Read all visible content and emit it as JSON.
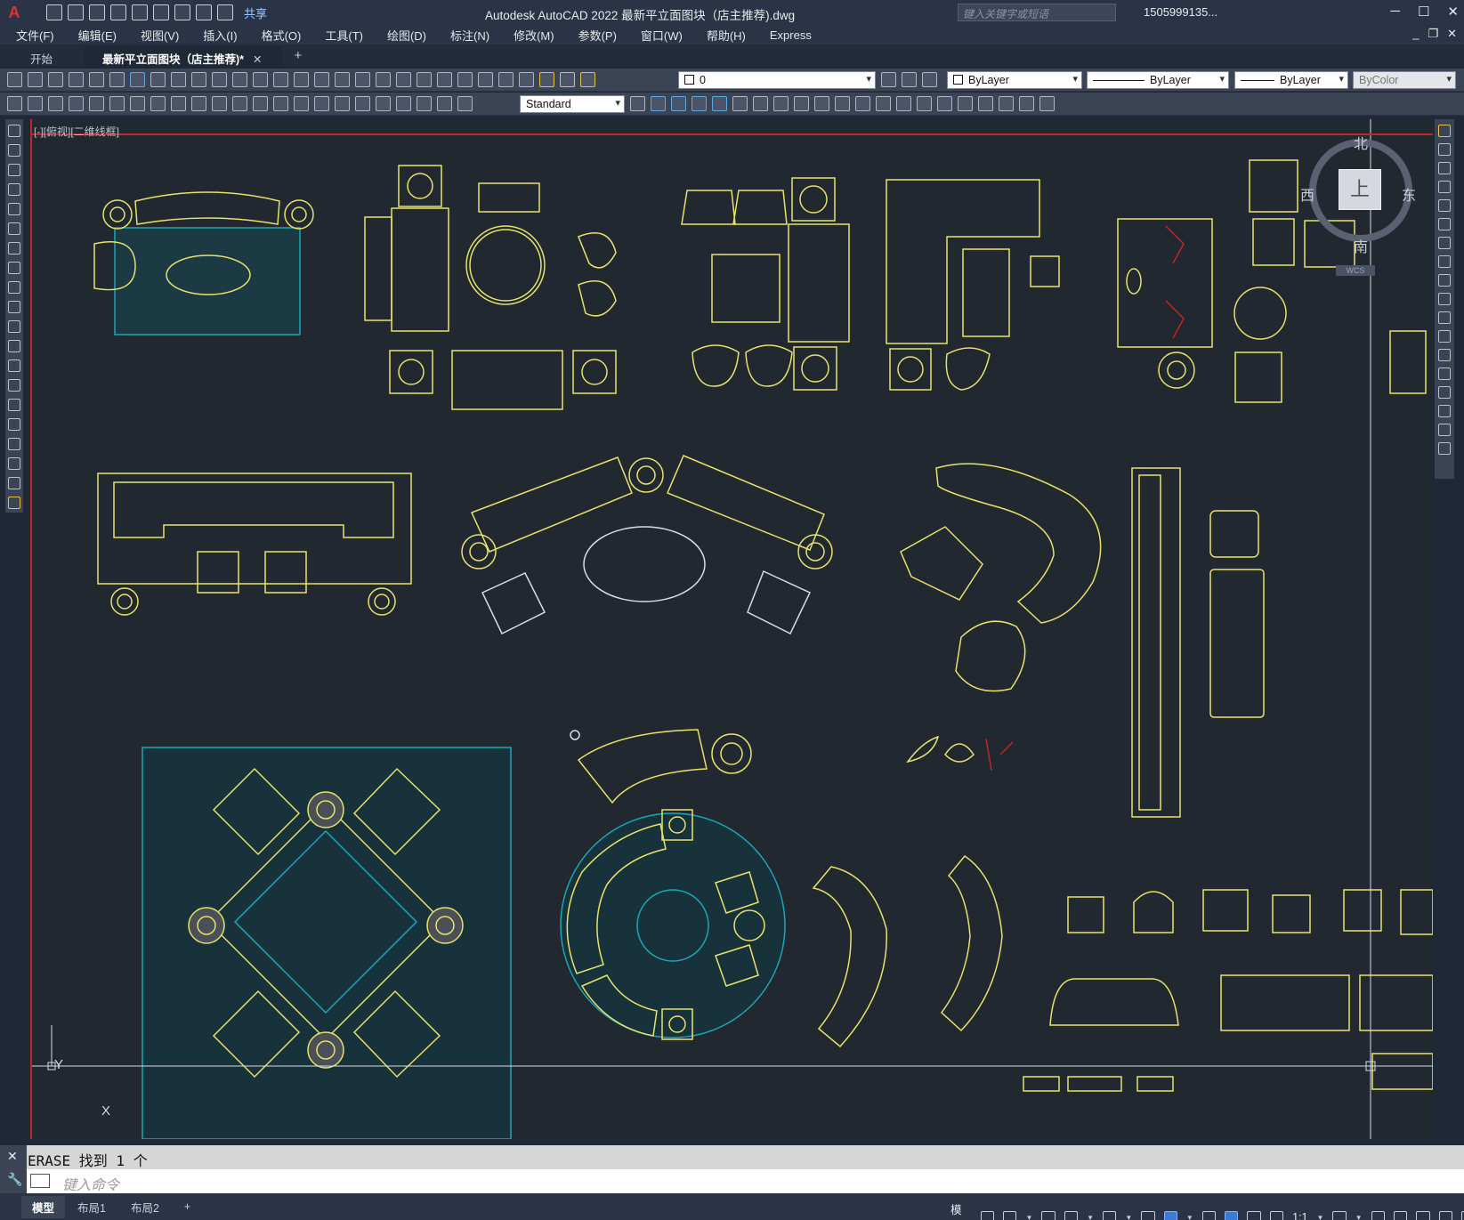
{
  "titlebar": {
    "app_title": "Autodesk AutoCAD 2022    最新平立面图块（店主推荐).dwg",
    "share_label": "共享",
    "search_placeholder": "键入关键字或短语",
    "user_name": "1505999135...",
    "logo": "A"
  },
  "menubar": {
    "items": [
      "文件(F)",
      "编辑(E)",
      "视图(V)",
      "插入(I)",
      "格式(O)",
      "工具(T)",
      "绘图(D)",
      "标注(N)",
      "修改(M)",
      "参数(P)",
      "窗口(W)",
      "帮助(H)",
      "Express"
    ]
  },
  "file_tabs": {
    "start_label": "开始",
    "active_label": "最新平立面图块（店主推荐)*",
    "close_glyph": "✕",
    "add_glyph": "+"
  },
  "properties_toolbar": {
    "layer_value": "0",
    "color_value": "ByLayer",
    "linetype_value": "ByLayer",
    "lineweight_value": "ByLayer",
    "plotstyle_value": "ByColor",
    "textstyle_value": "Standard"
  },
  "viewport": {
    "label": "[-][俯视][二维线框]",
    "ucs_x": "X",
    "ucs_y": "Y"
  },
  "viewcube": {
    "north": "北",
    "south": "南",
    "east": "东",
    "west": "西",
    "top_face": "上",
    "wcs_label": "WCS"
  },
  "command": {
    "history": "ERASE 找到 1 个",
    "placeholder": "键入命令"
  },
  "status": {
    "layout_tabs": [
      "模型",
      "布局1",
      "布局2"
    ],
    "add_glyph": "+",
    "model_label": "模型",
    "scale_label": "1:1"
  },
  "colors": {
    "drawing_bg": "#212830",
    "cad_yellow": "#e8e26a",
    "cad_cyan": "#1aa6b7",
    "cad_red": "#c0262b",
    "ui_dark": "#2a3446",
    "ui_panel": "#3b4454"
  }
}
